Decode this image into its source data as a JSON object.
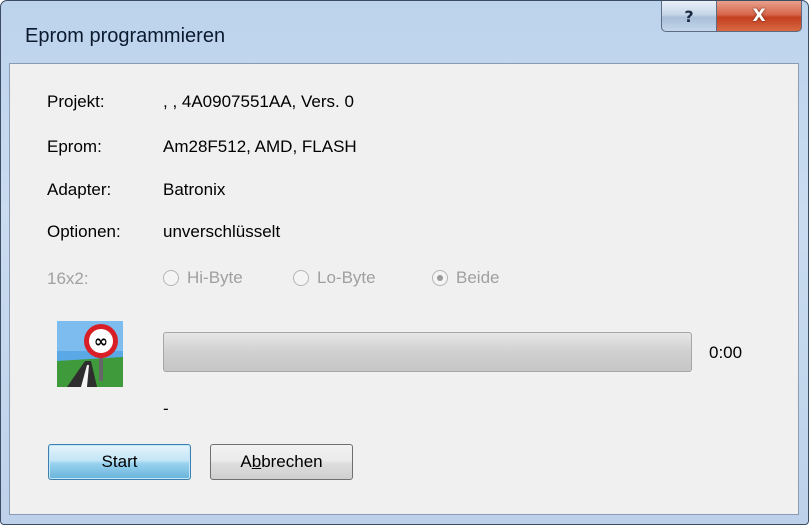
{
  "window": {
    "title": "Eprom programmieren",
    "help_label": "?",
    "close_label": "X"
  },
  "info": {
    "projekt_label": "Projekt:",
    "projekt_value": ", , 4A0907551AA, Vers. 0",
    "eprom_label": "Eprom:",
    "eprom_value": "Am28F512, AMD, FLASH",
    "adapter_label": "Adapter:",
    "adapter_value": "Batronix",
    "optionen_label": "Optionen:",
    "optionen_value": "unverschlüsselt"
  },
  "mode": {
    "label": "16x2:",
    "options": [
      {
        "label": "Hi-Byte",
        "checked": false
      },
      {
        "label": "Lo-Byte",
        "checked": false
      },
      {
        "label": "Beide",
        "checked": true
      }
    ],
    "enabled": false
  },
  "progress": {
    "value": 0,
    "time": "0:00",
    "status": "-"
  },
  "icon": "no-limit-road-sign-icon",
  "buttons": {
    "start": "Start",
    "cancel_prefix": "A",
    "cancel_underlined": "b",
    "cancel_rest": "brechen"
  },
  "colors": {
    "progress_fill": "#2eb84a",
    "close_button": "#c33f1f",
    "default_button_border": "#3c7fb1"
  }
}
